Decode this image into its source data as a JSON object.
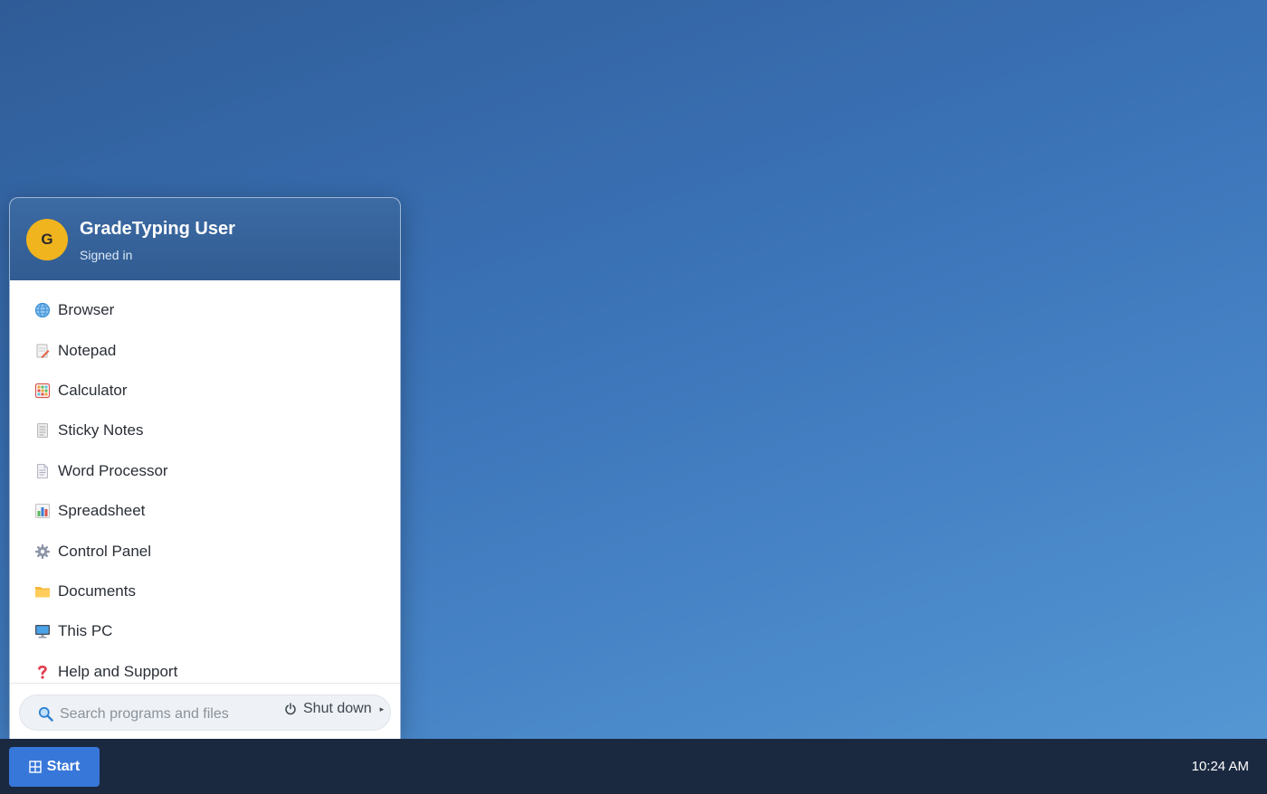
{
  "user": {
    "initial": "G",
    "name": "GradeTyping User",
    "status": "Signed in"
  },
  "apps": [
    {
      "label": "Browser",
      "icon": "globe-icon"
    },
    {
      "label": "Notepad",
      "icon": "notepad-icon"
    },
    {
      "label": "Calculator",
      "icon": "calculator-icon"
    },
    {
      "label": "Sticky Notes",
      "icon": "sticky-notes-icon"
    },
    {
      "label": "Word Processor",
      "icon": "document-icon"
    },
    {
      "label": "Spreadsheet",
      "icon": "bar-chart-icon"
    },
    {
      "label": "Control Panel",
      "icon": "gear-icon"
    },
    {
      "label": "Documents",
      "icon": "folder-icon"
    },
    {
      "label": "This PC",
      "icon": "computer-icon"
    },
    {
      "label": "Help and Support",
      "icon": "question-icon"
    }
  ],
  "search": {
    "placeholder": "Search programs and files"
  },
  "shutdown": {
    "label": "Shut down"
  },
  "taskbar": {
    "start_label": "Start",
    "clock": "10:24 AM"
  },
  "colors": {
    "desktop_gradient": [
      "#2f5c97",
      "#5497d3"
    ],
    "menu_header": "#315c92",
    "avatar": "#f0b41e",
    "start_button": "#3777d9",
    "taskbar": "#1a2940"
  }
}
